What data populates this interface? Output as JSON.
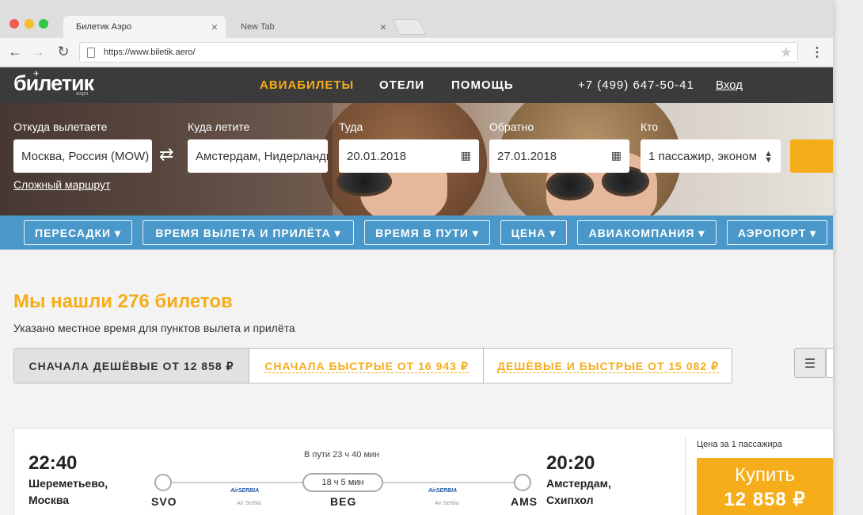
{
  "browser": {
    "tabs": [
      {
        "label": "Билетик Аэро",
        "close": "×"
      },
      {
        "label": "New Tab",
        "close": "×"
      }
    ],
    "url": "https://www.biletik.aero/"
  },
  "site": {
    "logo": "билетик",
    "logo_sub": "аэро",
    "nav": [
      "АВИАБИЛЕТЫ",
      "ОТЕЛИ",
      "ПОМОЩЬ"
    ],
    "phone": "+7 (499) 647-50-41",
    "login": "Вход"
  },
  "search": {
    "from_label": "Откуда вылетаете",
    "from_value": "Москва, Россия (MOW)",
    "to_label": "Куда летите",
    "to_value": "Амстердам, Нидерланды",
    "depart_label": "Туда",
    "depart_value": "20.01.2018",
    "return_label": "Обратно",
    "return_value": "27.01.2018",
    "who_label": "Кто",
    "who_value": "1 пассажир, эконом",
    "complex_route": "Сложный маршрут"
  },
  "filters": [
    "ПЕРЕСАДКИ ▾",
    "ВРЕМЯ ВЫЛЕТА И ПРИЛЁТА ▾",
    "ВРЕМЯ В ПУТИ ▾",
    "ЦЕНА ▾",
    "АВИАКОМПАНИЯ ▾",
    "АЭРОПОРТ ▾"
  ],
  "results": {
    "found": "Мы нашли 276 билетов",
    "note": "Указано местное время для пунктов вылета и прилёта",
    "sorts": [
      "СНАЧАЛА ДЕШЁВЫЕ ОТ 12 858 ₽",
      "СНАЧАЛА БЫСТРЫЕ ОТ 16 943 ₽",
      "ДЕШЁВЫЕ И БЫСТРЫЕ ОТ 15 082 ₽"
    ]
  },
  "ticket": {
    "dep_time": "22:40",
    "dep_place_1": "Шереметьево,",
    "dep_place_2": "Москва",
    "arr_time": "20:20",
    "arr_place_1": "Амстердам,",
    "arr_place_2": "Схипхол",
    "duration": "В пути 23 ч 40 мин",
    "layover": "18 ч 5 мин",
    "codes": [
      "SVO",
      "BEG",
      "AMS"
    ],
    "airline_logo": "AirSERBIA",
    "airline_name": "Air Serbia",
    "price_note": "Цена за 1 пассажира",
    "buy_label": "Купить",
    "price": "12 858 ₽"
  },
  "colors": {
    "accent": "#f6ad1a",
    "filter_bar": "#4a98c9",
    "header": "#3b3b3b"
  }
}
